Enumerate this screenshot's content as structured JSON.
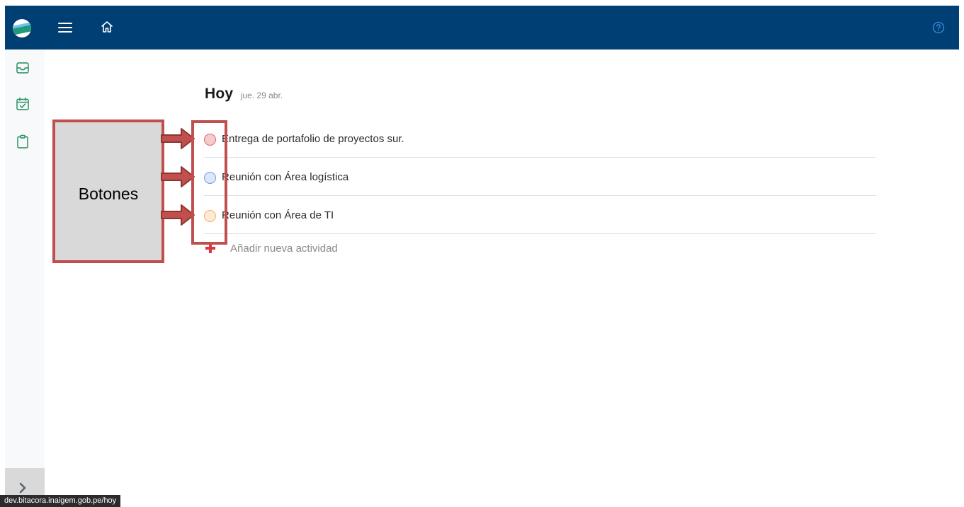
{
  "header": {
    "logo": "app-logo",
    "menu_icon": "hamburger-menu-icon",
    "home_icon": "home-icon",
    "help_icon": "help-circle-icon",
    "background_color": "#003f74"
  },
  "sidebar": {
    "items": [
      {
        "icon": "inbox-icon",
        "color": "#1e8c5a"
      },
      {
        "icon": "calendar-check-icon",
        "color": "#1e8c5a"
      },
      {
        "icon": "clipboard-icon",
        "color": "#1e8c5a"
      }
    ],
    "toggle_icon": "chevron-right-icon"
  },
  "main": {
    "title": "Hoy",
    "date": "jue. 29 abr.",
    "tasks": [
      {
        "label": "Entrega de portafolio de proyectos sur.",
        "color": "#e06666"
      },
      {
        "label": "Reunión con Área logística",
        "color": "#6d9eeb"
      },
      {
        "label": "Reunión con Área de TI",
        "color": "#f6b26b"
      }
    ],
    "add_label": "Añadir nueva actividad"
  },
  "annotation": {
    "label": "Botones",
    "color": "#c0504d"
  },
  "status_bar": {
    "url": "dev.bitacora.inaigem.gob.pe/hoy"
  }
}
